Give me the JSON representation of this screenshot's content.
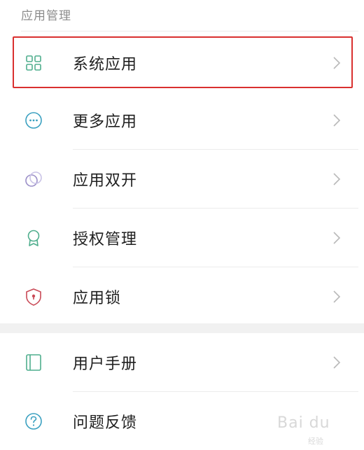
{
  "section": {
    "title": "应用管理"
  },
  "items": [
    {
      "label": "系统应用",
      "icon": "grid-icon"
    },
    {
      "label": "更多应用",
      "icon": "more-dots-icon"
    },
    {
      "label": "应用双开",
      "icon": "dual-circles-icon"
    },
    {
      "label": "授权管理",
      "icon": "badge-icon"
    },
    {
      "label": "应用锁",
      "icon": "lock-shield-icon"
    },
    {
      "label": "用户手册",
      "icon": "book-icon"
    },
    {
      "label": "问题反馈",
      "icon": "question-icon"
    }
  ],
  "colors": {
    "highlight": "#d9302f",
    "green": "#4fae8d",
    "teal": "#3aa0c0",
    "lavender": "#9b8fc8",
    "red": "#c94a57"
  },
  "watermark": {
    "brand": "Bai du",
    "sub": "经验"
  }
}
